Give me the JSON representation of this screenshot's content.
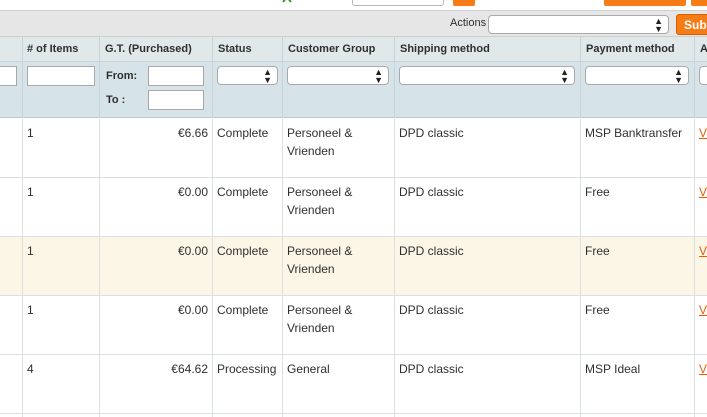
{
  "massaction": {
    "actions_label": "Actions",
    "actions_value": "",
    "submit_label": "Subm"
  },
  "columns": {
    "items": "# of Items",
    "gt_purchased": "G.T. (Purchased)",
    "status": "Status",
    "customer_group": "Customer Group",
    "shipping_method": "Shipping method",
    "payment_method": "Payment method",
    "action_partial": "A"
  },
  "filters": {
    "from_label": "From:",
    "to_label": "To :",
    "items_value": "",
    "from_value": "",
    "to_value": "",
    "status_value": "",
    "customer_group_value": "",
    "shipping_value": "",
    "payment_value": ""
  },
  "rows": [
    {
      "items": "1",
      "total": "€6.66",
      "status": "Complete",
      "group_line1": "Personeel &",
      "group_line2": "Vrienden",
      "shipping": "DPD classic",
      "payment": "MSP Banktransfer",
      "action": "V"
    },
    {
      "items": "1",
      "total": "€0.00",
      "status": "Complete",
      "group_line1": "Personeel &",
      "group_line2": "Vrienden",
      "shipping": "DPD classic",
      "payment": "Free",
      "action": "V"
    },
    {
      "items": "1",
      "total": "€0.00",
      "status": "Complete",
      "group_line1": "Personeel &",
      "group_line2": "Vrienden",
      "shipping": "DPD classic",
      "payment": "Free",
      "action": "V"
    },
    {
      "items": "1",
      "total": "€0.00",
      "status": "Complete",
      "group_line1": "Personeel &",
      "group_line2": "Vrienden",
      "shipping": "DPD classic",
      "payment": "Free",
      "action": "V"
    },
    {
      "items": "4",
      "total": "€64.62",
      "status": "Processing",
      "group_line1": "General",
      "group_line2": "",
      "shipping": "DPD classic",
      "payment": "MSP Ideal",
      "action": "V"
    }
  ],
  "colors": {
    "accent_orange": "#f77c16",
    "header_bg": "#e1e8ea",
    "filter_bg": "#d6e4e9",
    "highlight_row": "#fbf6e6",
    "link": "#eb5e00"
  }
}
